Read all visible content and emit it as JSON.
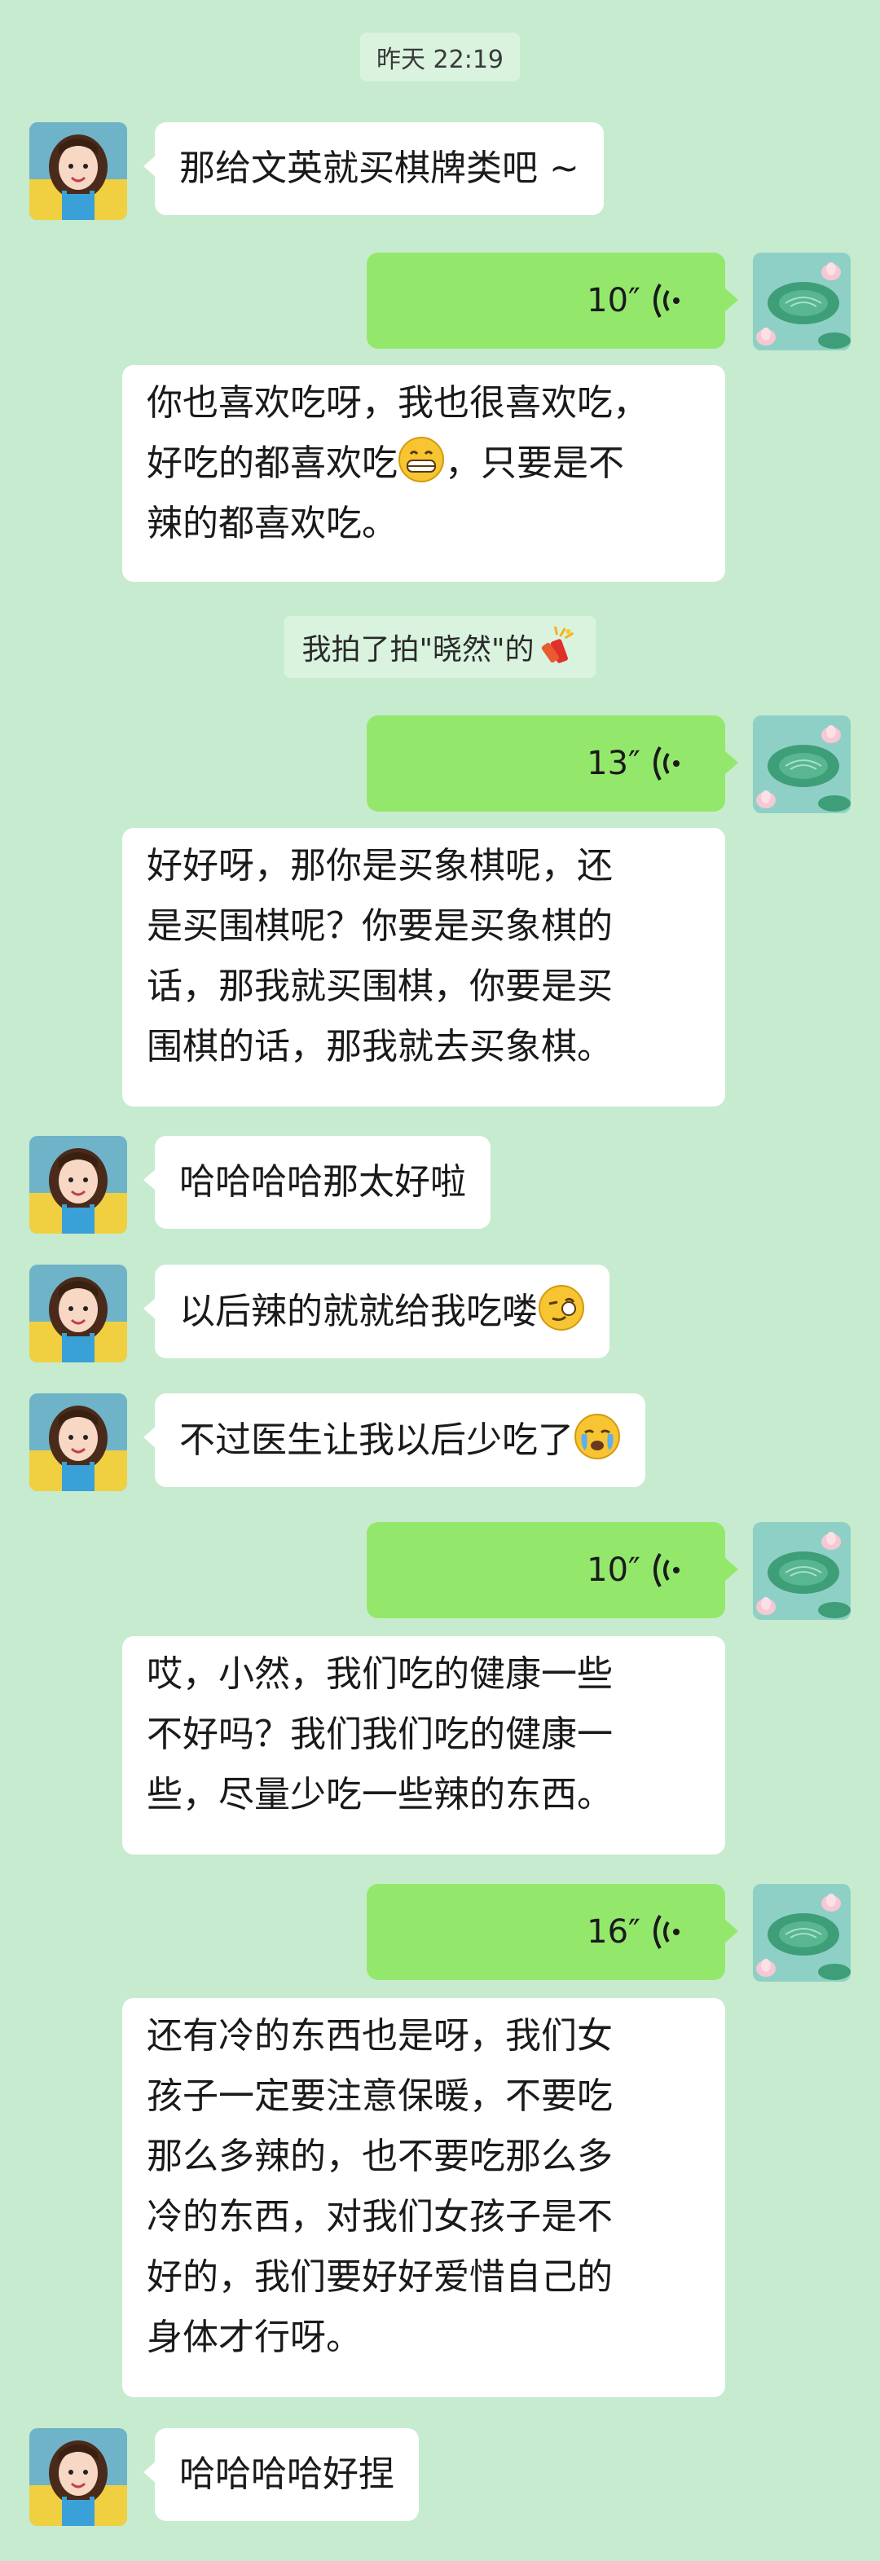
{
  "chat": {
    "timestamp": "昨天 22:19",
    "messages": [
      {
        "id": "m1",
        "from": "other",
        "type": "text",
        "text": "那给文英就买棋牌类吧 ~"
      },
      {
        "id": "m2",
        "from": "me",
        "type": "voice",
        "duration": "10″",
        "transcript": "你也喜欢吃呀，我也很喜欢吃，\n好吃的都喜欢吃",
        "transcript_tail": "，只要是不\n辣的都喜欢吃。",
        "emoji": "grin-emoji"
      },
      {
        "id": "m3",
        "from": "system",
        "type": "pat",
        "text": "我拍了拍\"晓然\"的",
        "emoji": "firecracker-emoji"
      },
      {
        "id": "m4",
        "from": "me",
        "type": "voice",
        "duration": "13″",
        "transcript": "好好呀，那你是买象棋呢，还\n是买围棋呢？你要是买象棋的\n话，那我就买围棋，你要是买\n围棋的话，那我就去买象棋。"
      },
      {
        "id": "m5",
        "from": "other",
        "type": "text",
        "text": "哈哈哈哈那太好啦"
      },
      {
        "id": "m6",
        "from": "other",
        "type": "text",
        "text": "以后辣的就就给我吃喽",
        "emoji": "wink-emoji"
      },
      {
        "id": "m7",
        "from": "other",
        "type": "text",
        "text": "不过医生让我以后少吃了",
        "emoji": "crying-emoji"
      },
      {
        "id": "m8",
        "from": "me",
        "type": "voice",
        "duration": "10″",
        "transcript": "哎，小然，我们吃的健康一些\n不好吗？我们我们吃的健康一\n些，尽量少吃一些辣的东西。"
      },
      {
        "id": "m9",
        "from": "me",
        "type": "voice",
        "duration": "16″",
        "transcript": "还有冷的东西也是呀，我们女\n孩子一定要注意保暖，不要吃\n那么多辣的，也不要吃那么多\n冷的东西，对我们女孩子是不\n好的，我们要好好爱惜自己的\n身体才行呀。"
      },
      {
        "id": "m10",
        "from": "other",
        "type": "text",
        "text": "哈哈哈哈好捏"
      }
    ]
  },
  "colors": {
    "background": "#c6ebcf",
    "my_bubble": "#93e86b",
    "their_bubble": "#ffffff",
    "system_bubble": "#d9f3df"
  }
}
